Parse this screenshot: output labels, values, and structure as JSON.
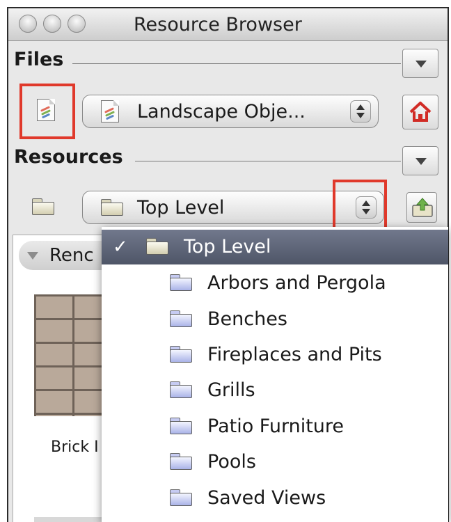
{
  "window": {
    "title": "Resource Browser"
  },
  "files": {
    "label": "Files",
    "file_popup": "Landscape Obje..."
  },
  "resources": {
    "label": "Resources",
    "folder_popup": "Top Level"
  },
  "content": {
    "group_header": "Renc",
    "thumb_label": "Brick I"
  },
  "menu": {
    "check": "✓",
    "items": [
      {
        "label": "Top Level",
        "selected": true
      },
      {
        "label": "Arbors and Pergola",
        "selected": false
      },
      {
        "label": "Benches",
        "selected": false
      },
      {
        "label": "Fireplaces and Pits",
        "selected": false
      },
      {
        "label": "Grills",
        "selected": false
      },
      {
        "label": "Patio Furniture",
        "selected": false
      },
      {
        "label": "Pools",
        "selected": false
      },
      {
        "label": "Saved Views",
        "selected": false
      }
    ]
  },
  "colors": {
    "highlight": "#e0392b",
    "menu_selected": "#5d6478",
    "home_icon": "#d12b25"
  },
  "icons": [
    "close-light",
    "minimize-light",
    "zoom-light",
    "document-icon",
    "home-icon",
    "folder-icon",
    "folder-up-icon",
    "disclosure-triangle-icon",
    "checkmark-icon"
  ]
}
